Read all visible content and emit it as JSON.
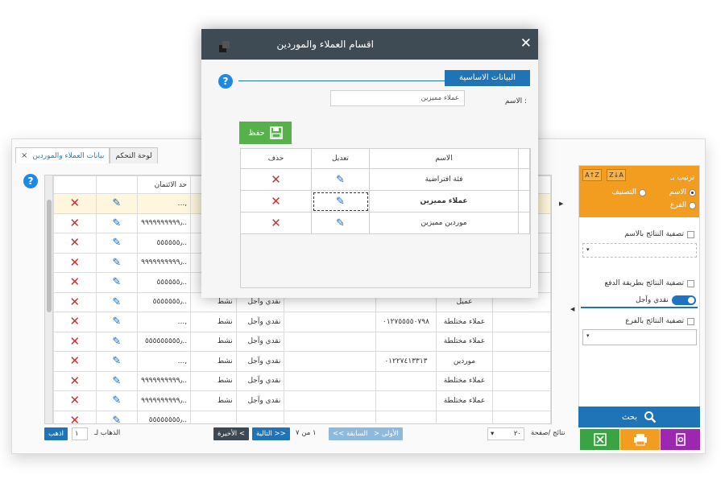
{
  "app": {
    "tabs": [
      {
        "label": "لوحة التحكم",
        "active": false
      },
      {
        "label": "بيانات العملاء والموردين",
        "active": true
      }
    ],
    "tab_close": "×",
    "help_glyph": "?"
  },
  "grid": {
    "credit_header": "حد الائتمان",
    "rows": [
      {
        "credit": "...,",
        "status": "",
        "pay": "",
        "phone": "",
        "type": "",
        "selected": true
      },
      {
        "credit": "٩٩٩٩٩٩٩٩٩٩٫..",
        "status": "",
        "pay": "",
        "phone": "",
        "type": ""
      },
      {
        "credit": "٥٥٥٥٥٥٫..",
        "status": "",
        "pay": "",
        "phone": "",
        "type": ""
      },
      {
        "credit": "٩٩٩٩٩٩٩٩٩٩٫..",
        "status": "",
        "pay": "",
        "phone": "",
        "type": ""
      },
      {
        "credit": "٥٥٥٥٥٥٫..",
        "status": "",
        "pay": "",
        "phone": "",
        "type": ""
      },
      {
        "credit": "٥٥٥٥٥٥٥٫..",
        "status": "نشط",
        "pay": "نقدي وآجل",
        "phone": "",
        "type": "عميل"
      },
      {
        "credit": "...,",
        "status": "نشط",
        "pay": "نقدي وآجل",
        "phone": "٠١٢٧٥٥٥٥٠٧٩٨",
        "type": "عملاء مختلطة"
      },
      {
        "credit": "٥٥٥٥٥٥٥٥٥٫..",
        "status": "نشط",
        "pay": "نقدي وآجل",
        "phone": "",
        "type": "عملاء مختلطة"
      },
      {
        "credit": "...,",
        "status": "نشط",
        "pay": "نقدي وآجل",
        "phone": "٠١٢٢٧٤١٣٣١٣",
        "type": "موردين"
      },
      {
        "credit": "٩٩٩٩٩٩٩٩٩٩٫..",
        "status": "نشط",
        "pay": "نقدي وآجل",
        "phone": "",
        "type": "عملاء مختلطة"
      },
      {
        "credit": "٩٩٩٩٩٩٩٩٩٩٫..",
        "status": "نشط",
        "pay": "نقدي وآجل",
        "phone": "",
        "type": "عملاء مختلطة"
      },
      {
        "credit": "٥٥٥٥٥٥٥٥٫..",
        "status": "",
        "pay": "",
        "phone": "",
        "type": ""
      }
    ]
  },
  "pager": {
    "goto_btn": "اذهب",
    "goto_value": "١",
    "goto_label": "الذهاب لـ",
    "last": "الأخيرة <",
    "next": "التالية >>",
    "page_info": "١ من ٧",
    "prev": "<< السابقة",
    "first": "> الأولى",
    "page_size": "٢٠",
    "page_size_label": "نتائج /صفحة"
  },
  "filters": {
    "sort_label": "ترتيب بـ",
    "sort_options": [
      "الاسم",
      "التصنيف",
      "الفرع"
    ],
    "sort_btn_asc": "A↑Z",
    "sort_btn_desc": "Z↓A",
    "filter_by_name": "تصفية النتائج بالاسم",
    "filter_by_payment": "تصفية النتائج بطريقة الدفع",
    "payment_value": "نقدي وآجل",
    "filter_by_branch": "تصفية النتائج بالفرع",
    "search_label": "بحث"
  },
  "modal": {
    "title": "اقسام العملاء والموردين",
    "close": "✕",
    "section_title": "البيانات الاساسية",
    "name_label": "الاسم :",
    "name_value": "عملاء مميزين",
    "save_label": "حفظ",
    "table_headers": {
      "name": "الاسم",
      "edit": "تعديل",
      "delete": "حذف"
    },
    "rows": [
      {
        "name": "فئة افتراضية",
        "bold": false
      },
      {
        "name": "عملاء مميزين",
        "bold": true
      },
      {
        "name": "موردين مميزين",
        "bold": false
      }
    ]
  },
  "colors": {
    "primary": "#1f73b7",
    "header_dark": "#3e4b55",
    "orange": "#f29d20",
    "green": "#56b14a",
    "delete_red": "#d32f2f",
    "purple": "#9c27b0"
  },
  "icons": [
    "help-icon",
    "close-icon",
    "delete-icon",
    "edit-icon",
    "save-icon",
    "search-icon",
    "excel-export-icon",
    "print-icon",
    "pdf-export-icon",
    "app-logo-icon"
  ]
}
